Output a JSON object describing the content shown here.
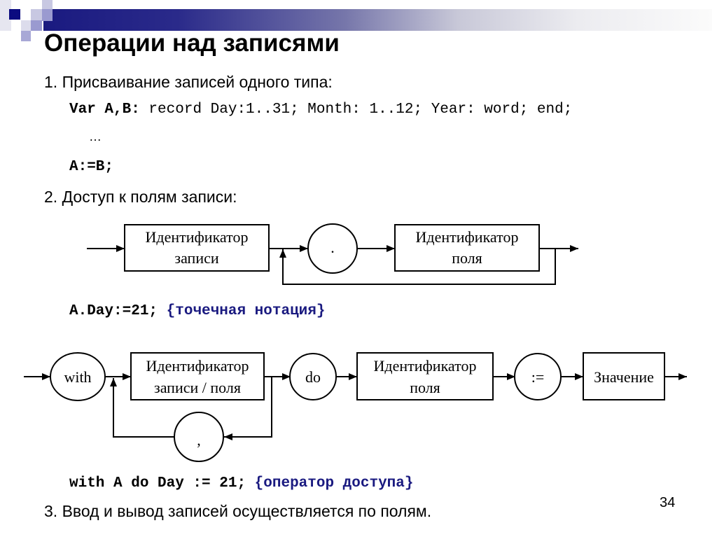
{
  "slide": {
    "title": "Операции над записями",
    "page_number": "34",
    "colors": {
      "accent": "#1a1a80",
      "comment": "#1a1a80"
    },
    "item1": {
      "label": "1. Присваивание записей одного типа:",
      "code_decl_keyword": "Var A,B:",
      "code_decl_rest": " record Day:1..31; Month: 1..12; Year: word; end;",
      "ellipsis": "…",
      "code_assign": "A:=B;"
    },
    "item2": {
      "label": "2. Доступ к полям записи:",
      "diagram1": {
        "box1_line1": "Идентификатор",
        "box1_line2": "записи",
        "circle": ".",
        "box2_line1": "Идентификатор",
        "box2_line2": "поля"
      },
      "code_dot": "A.Day:=21;",
      "comment_dot": "{точечная нотация}",
      "diagram2": {
        "circle_with": "with",
        "box1_line1": "Идентификатор",
        "box1_line2": "записи / поля",
        "circle_comma": ",",
        "circle_do": "do",
        "box2_line1": "Идентификатор",
        "box2_line2": "поля",
        "circle_assign": ":=",
        "box3": "Значение"
      },
      "code_with": "with A do Day := 21;",
      "comment_with": "{оператор доступа}"
    },
    "item3": {
      "label": "3. Ввод и вывод записей осуществляется по полям."
    }
  }
}
